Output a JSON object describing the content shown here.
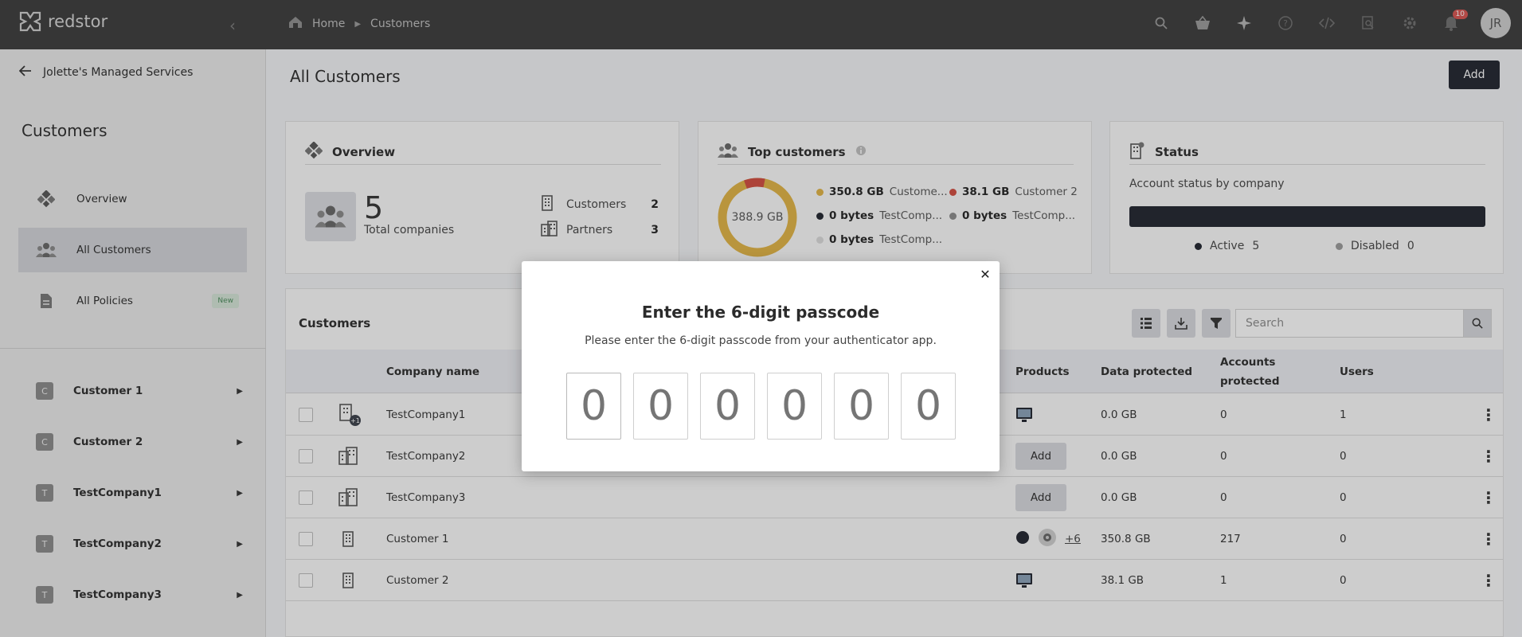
{
  "topbar": {
    "logo_text": "redstor",
    "breadcrumb": [
      "Home",
      "Customers"
    ],
    "notification_count": "10",
    "avatar_initials": "JR"
  },
  "sidebar": {
    "back_label": "Jolette's Managed Services",
    "title": "Customers",
    "nav": [
      {
        "label": "Overview",
        "icon": "overview-icon"
      },
      {
        "label": "All Customers",
        "icon": "users-icon"
      },
      {
        "label": "All Policies",
        "icon": "document-icon",
        "badge": "New"
      }
    ],
    "customers": [
      {
        "letter": "C",
        "name": "Customer 1"
      },
      {
        "letter": "C",
        "name": "Customer 2"
      },
      {
        "letter": "T",
        "name": "TestCompany1"
      },
      {
        "letter": "T",
        "name": "TestCompany2"
      },
      {
        "letter": "T",
        "name": "TestCompany3"
      }
    ]
  },
  "main": {
    "title": "All Customers",
    "add_label": "Add"
  },
  "overview": {
    "title": "Overview",
    "total": "5",
    "total_label": "Total companies",
    "rows": [
      {
        "label": "Customers",
        "value": "2"
      },
      {
        "label": "Partners",
        "value": "3"
      }
    ]
  },
  "top_customers": {
    "title": "Top customers",
    "total": "388.9 GB",
    "items": [
      {
        "size": "350.8 GB",
        "name": "Custome...",
        "color": "#e2b443"
      },
      {
        "size": "38.1 GB",
        "name": "Customer 2",
        "color": "#d24b3e"
      },
      {
        "size": "0 bytes",
        "name": "TestComp...",
        "color": "#1f232d"
      },
      {
        "size": "0 bytes",
        "name": "TestComp...",
        "color": "#8c8c8c"
      },
      {
        "size": "0 bytes",
        "name": "TestComp...",
        "color": "#dcdcdc"
      }
    ]
  },
  "status": {
    "title": "Status",
    "subtitle": "Account status by company",
    "legend": [
      {
        "label": "Active",
        "value": "5",
        "color": "#1f232d"
      },
      {
        "label": "Disabled",
        "value": "0",
        "color": "#9a9a9a"
      }
    ]
  },
  "table": {
    "title": "Customers",
    "search_placeholder": "Search",
    "columns": {
      "company": "Company name",
      "products": "Products",
      "data": "Data protected",
      "accounts": "Accounts protected",
      "users": "Users"
    },
    "rows": [
      {
        "name": "TestCompany1",
        "product": "monitor",
        "data": "0.0 GB",
        "accounts": "0",
        "users": "1"
      },
      {
        "name": "TestCompany2",
        "product": "add",
        "data": "0.0 GB",
        "accounts": "0",
        "users": "0"
      },
      {
        "name": "TestCompany3",
        "product": "add",
        "data": "0.0 GB",
        "accounts": "0",
        "users": "0"
      },
      {
        "name": "Customer 1",
        "product": "multi",
        "more": "+6",
        "data": "350.8 GB",
        "accounts": "217",
        "users": "0"
      },
      {
        "name": "Customer 2",
        "product": "monitor",
        "data": "38.1 GB",
        "accounts": "1",
        "users": "0"
      }
    ],
    "add_product_label": "Add"
  },
  "modal": {
    "title": "Enter the 6-digit passcode",
    "subtitle": "Please enter the 6-digit passcode from your authenticator app.",
    "digit_placeholder": "0"
  }
}
